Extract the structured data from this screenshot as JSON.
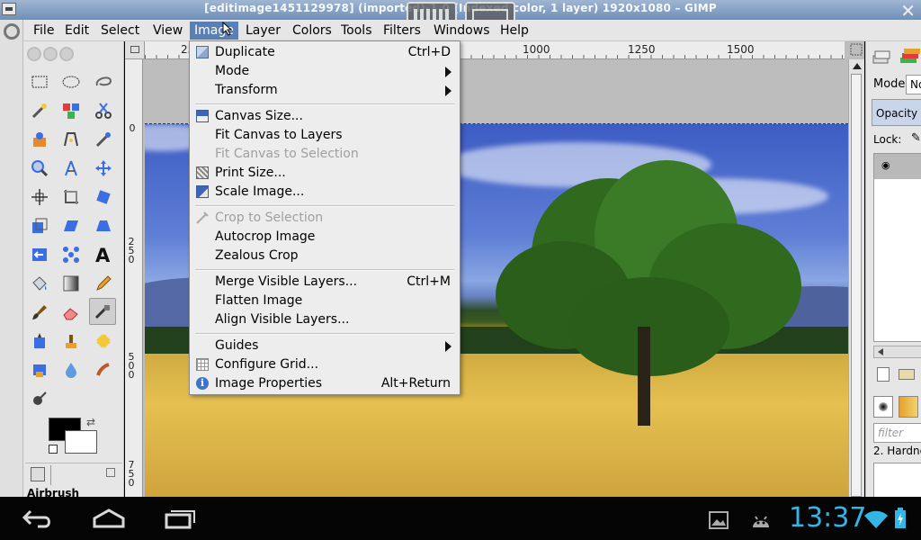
{
  "window": {
    "title": "[editimage1451129978] (imported)-1.0 (Indexed color, 1 layer) 1920x1080 – GIMP",
    "close_symbol": "✕"
  },
  "menubar": {
    "items": [
      "File",
      "Edit",
      "Select",
      "View",
      "Image",
      "Layer",
      "Colors",
      "Tools",
      "Filters",
      "Windows",
      "Help"
    ],
    "active": "Image"
  },
  "image_menu": {
    "items": [
      {
        "label": "Duplicate",
        "shortcut": "Ctrl+D",
        "icon": "duplicate-icon",
        "enabled": true
      },
      {
        "label": "Mode",
        "submenu": true,
        "enabled": true
      },
      {
        "label": "Transform",
        "submenu": true,
        "enabled": true
      },
      {
        "label": "Canvas Size...",
        "icon": "canvas-size-icon",
        "enabled": true
      },
      {
        "label": "Fit Canvas to Layers",
        "enabled": true
      },
      {
        "label": "Fit Canvas to Selection",
        "enabled": false
      },
      {
        "label": "Print Size...",
        "icon": "print-size-icon",
        "enabled": true
      },
      {
        "label": "Scale Image...",
        "icon": "scale-image-icon",
        "enabled": true
      },
      {
        "label": "Crop to Selection",
        "icon": "crop-icon",
        "enabled": false
      },
      {
        "label": "Autocrop Image",
        "enabled": true
      },
      {
        "label": "Zealous Crop",
        "enabled": true
      },
      {
        "label": "Merge Visible Layers...",
        "shortcut": "Ctrl+M",
        "enabled": true
      },
      {
        "label": "Flatten Image",
        "enabled": true
      },
      {
        "label": "Align Visible Layers...",
        "enabled": true
      },
      {
        "label": "Guides",
        "submenu": true,
        "enabled": true
      },
      {
        "label": "Configure Grid...",
        "icon": "grid-icon",
        "enabled": true
      },
      {
        "label": "Image Properties",
        "shortcut": "Alt+Return",
        "icon": "info-icon",
        "enabled": true
      }
    ]
  },
  "ruler": {
    "h_labels": [
      "250",
      "1000",
      "1250",
      "1500"
    ],
    "v_labels": [
      "0",
      "250",
      "500",
      "750"
    ]
  },
  "toolbox": {
    "active_tool_label": "Airbrush"
  },
  "dock": {
    "mode_label": "Mode:",
    "mode_value": "No",
    "opacity_label": "Opacity",
    "lock_label": "Lock:",
    "filter_placeholder": "filter",
    "brush_name": "2. Hardne"
  },
  "statusbar": {
    "time": "13:37"
  },
  "colors": {
    "accent": "#5a7fb4",
    "clock": "#33b5e5"
  }
}
